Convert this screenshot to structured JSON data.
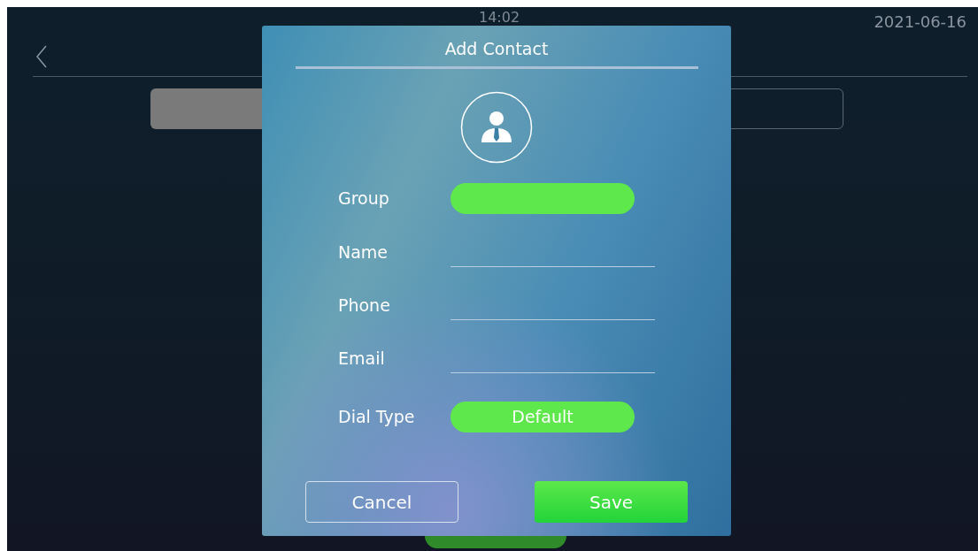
{
  "status_bar": {
    "time": "14:02",
    "date": "2021-06-16"
  },
  "dialog": {
    "title": "Add Contact",
    "fields": [
      {
        "label": "Group",
        "kind": "select"
      },
      {
        "label": "Name",
        "kind": "text"
      },
      {
        "label": "Phone",
        "kind": "text"
      },
      {
        "label": "Email",
        "kind": "text"
      },
      {
        "label": "Dial Type",
        "kind": "select",
        "value": "Default"
      }
    ],
    "buttons": [
      {
        "label": "Cancel",
        "kind": "secondary"
      },
      {
        "label": "Save",
        "kind": "primary"
      }
    ]
  }
}
